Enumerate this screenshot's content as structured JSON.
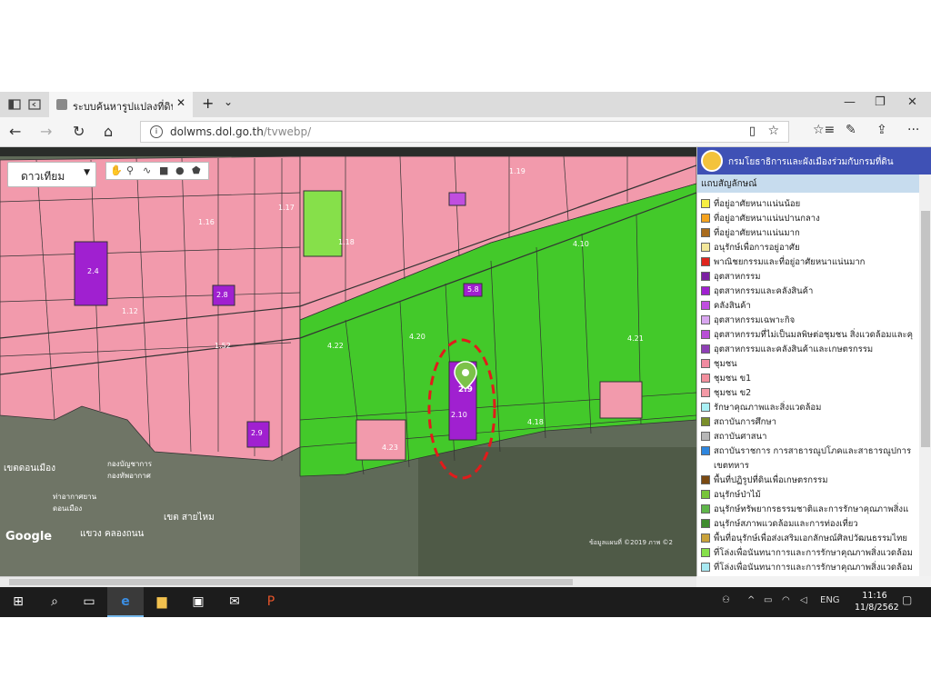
{
  "browser": {
    "tab_title": "ระบบค้นหารูปแปลงที่ดิน",
    "tab_close": "✕",
    "new_tab": "+",
    "tab_menu": "⌄",
    "url_host": "dolwms.dol.go.th",
    "url_path": "/tvwebp/",
    "window_minimize": "—",
    "window_restore": "❐",
    "window_close": "✕"
  },
  "map": {
    "basemap_value": "ดาวเทียม",
    "google_logo": "Google",
    "copyright": "ข้อมูลแผนที่ ©2019 ภาพ ©2",
    "district_labels": [
      "เขตดอนเมือง",
      "เขต สายไหม",
      "แขวง คลองถนน",
      "กองบัญชาการ กองทัพอากาศ",
      "ท่าอากาศยาน ดอนเมือง"
    ],
    "parcel_codes": [
      "1.19",
      "1.18",
      "2.4",
      "2.8",
      "2.9",
      "2.10",
      "4.10",
      "4.20",
      "4.22",
      "4.23",
      "4.21",
      "4.18",
      "5.8",
      "1.12",
      "1.16",
      "1.52",
      "1.17"
    ],
    "marker_code": "2.9"
  },
  "legend": {
    "org": "กรมโยธาธิการและผังเมืองร่วมกับกรมที่ดิน",
    "title": "แถบสัญลักษณ์",
    "items": [
      {
        "label": "ที่อยู่อาศัยหนาแน่นน้อย",
        "color": "#f7ee42"
      },
      {
        "label": "ที่อยู่อาศัยหนาแน่นปานกลาง",
        "color": "#f4a21e"
      },
      {
        "label": "ที่อยู่อาศัยหนาแน่นมาก",
        "color": "#a96b1d"
      },
      {
        "label": "อนุรักษ์เพื่อการอยู่อาศัย",
        "color": "#f3e79a"
      },
      {
        "label": "พาณิชยกรรมและที่อยู่อาศัยหนาแน่นมาก",
        "color": "#e0251e"
      },
      {
        "label": "อุตสาหกรรม",
        "color": "#7b1fa2"
      },
      {
        "label": "อุตสาหกรรมและคลังสินค้า",
        "color": "#a020d0"
      },
      {
        "label": "คลังสินค้า",
        "color": "#c04ee0"
      },
      {
        "label": "อุตสาหกรรมเฉพาะกิจ",
        "color": "#d9a6f0"
      },
      {
        "label": "อุตสาหกรรมที่ไม่เป็นมลพิษต่อชุมชน สิ่งแวดล้อมและคุ",
        "color": "#b84fd6"
      },
      {
        "label": "อุตสาหกรรมและคลังสินค้าและเกษตรกรรม",
        "color": "#8e3fb5"
      },
      {
        "label": "ชุมชน",
        "color": "#f08aa0"
      },
      {
        "label": "ชุมชน ข1",
        "color": "#f28f9d"
      },
      {
        "label": "ชุมชน ข2",
        "color": "#f49aa6"
      },
      {
        "label": "รักษาคุณภาพและสิ่งแวดล้อม",
        "color": "#a9f0f5"
      },
      {
        "label": "สถาบันการศึกษา",
        "color": "#7a8e2a"
      },
      {
        "label": "สถาบันศาสนา",
        "color": "#b7b7b7"
      },
      {
        "label": "สถาบันราชการ การสาธารณูปโภคและสาธารณูปการ",
        "color": "#2e86de"
      },
      {
        "label": "เขตทหาร",
        "color": ""
      },
      {
        "label": "พื้นที่ปฏิรูปที่ดินเพื่อเกษตรกรรม",
        "color": "#7a4a12"
      },
      {
        "label": "อนุรักษ์ป่าไม้",
        "color": "#78c43a"
      },
      {
        "label": "อนุรักษ์ทรัพยากรธรรมชาติและการรักษาคุณภาพสิ่งแ",
        "color": "#5fb64a"
      },
      {
        "label": "อนุรักษ์สภาพแวดล้อมและการท่องเที่ยว",
        "color": "#3f8c2e"
      },
      {
        "label": "พื้นที่อนุรักษ์เพื่อส่งเสริมเอกลักษณ์ศิลปวัฒนธรรมไทย",
        "color": "#c9a23a"
      },
      {
        "label": "ที่โล่งเพื่อนันทนาการและการรักษาคุณภาพสิ่งแวดล้อม",
        "color": "#86e04a"
      },
      {
        "label": "ที่โล่งเพื่อนันทนาการและการรักษาคุณภาพสิ่งแวดล้อม",
        "color": "#a7e9f2"
      }
    ]
  },
  "taskbar": {
    "language": "ENG",
    "time": "11:16",
    "date": "11/8/2562"
  }
}
